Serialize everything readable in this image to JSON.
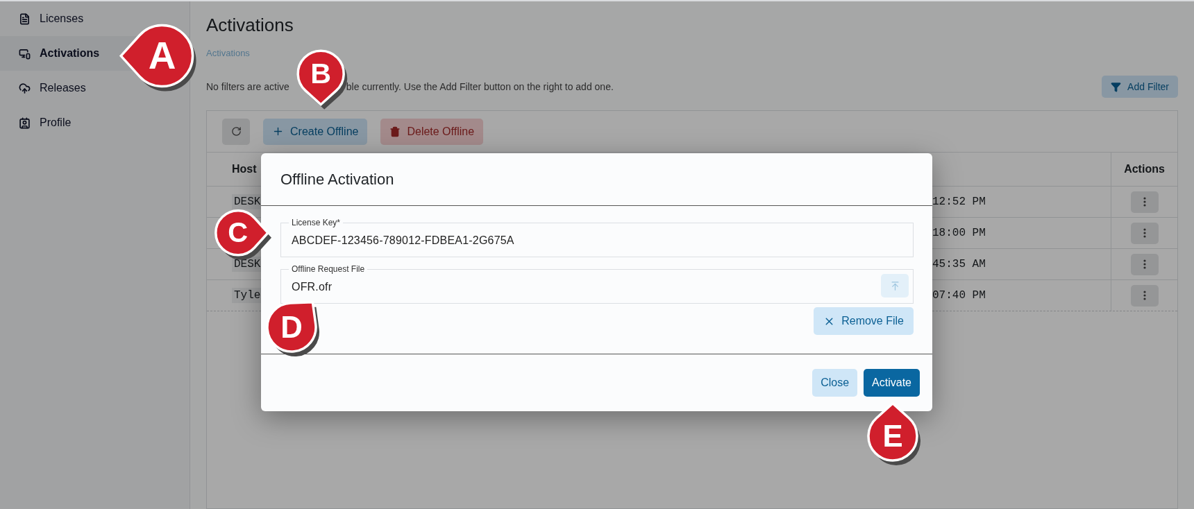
{
  "sidebar": {
    "items": [
      {
        "label": "Licenses",
        "selected": false
      },
      {
        "label": "Activations",
        "selected": true
      },
      {
        "label": "Releases",
        "selected": false
      },
      {
        "label": "Profile",
        "selected": false
      }
    ]
  },
  "page": {
    "title": "Activations",
    "breadcrumb": "Activations",
    "filter_notice": [
      "No filters are active",
      "ble currently. Use the Add Filter button on the right to add one."
    ],
    "add_filter": "Add Filter"
  },
  "toolbar": {
    "create": "Create Offline",
    "delete": "Delete Offline"
  },
  "table": {
    "columns": [
      "Host",
      "Actions"
    ],
    "rows": [
      {
        "host": "DESK",
        "time": "12:52 PM"
      },
      {
        "time": "18:00 PM"
      },
      {
        "host": "DESK",
        "time": "45:35 AM"
      },
      {
        "host": "Tyle",
        "time": "07:40 PM"
      }
    ]
  },
  "dialog": {
    "title": "Offline Activation",
    "fields": [
      {
        "label": "License Key*",
        "value": "ABCDEF-123456-789012-FDBEA1-2G675A",
        "kind": "text"
      },
      {
        "label": "Offline Request File",
        "value": "OFR.ofr",
        "kind": "file"
      }
    ],
    "remove_file": "Remove File",
    "buttons": [
      "Close",
      "Activate"
    ]
  },
  "callouts": [
    {
      "label": "A"
    },
    {
      "label": "B"
    },
    {
      "label": "C"
    },
    {
      "label": "D"
    },
    {
      "label": "E"
    }
  ]
}
